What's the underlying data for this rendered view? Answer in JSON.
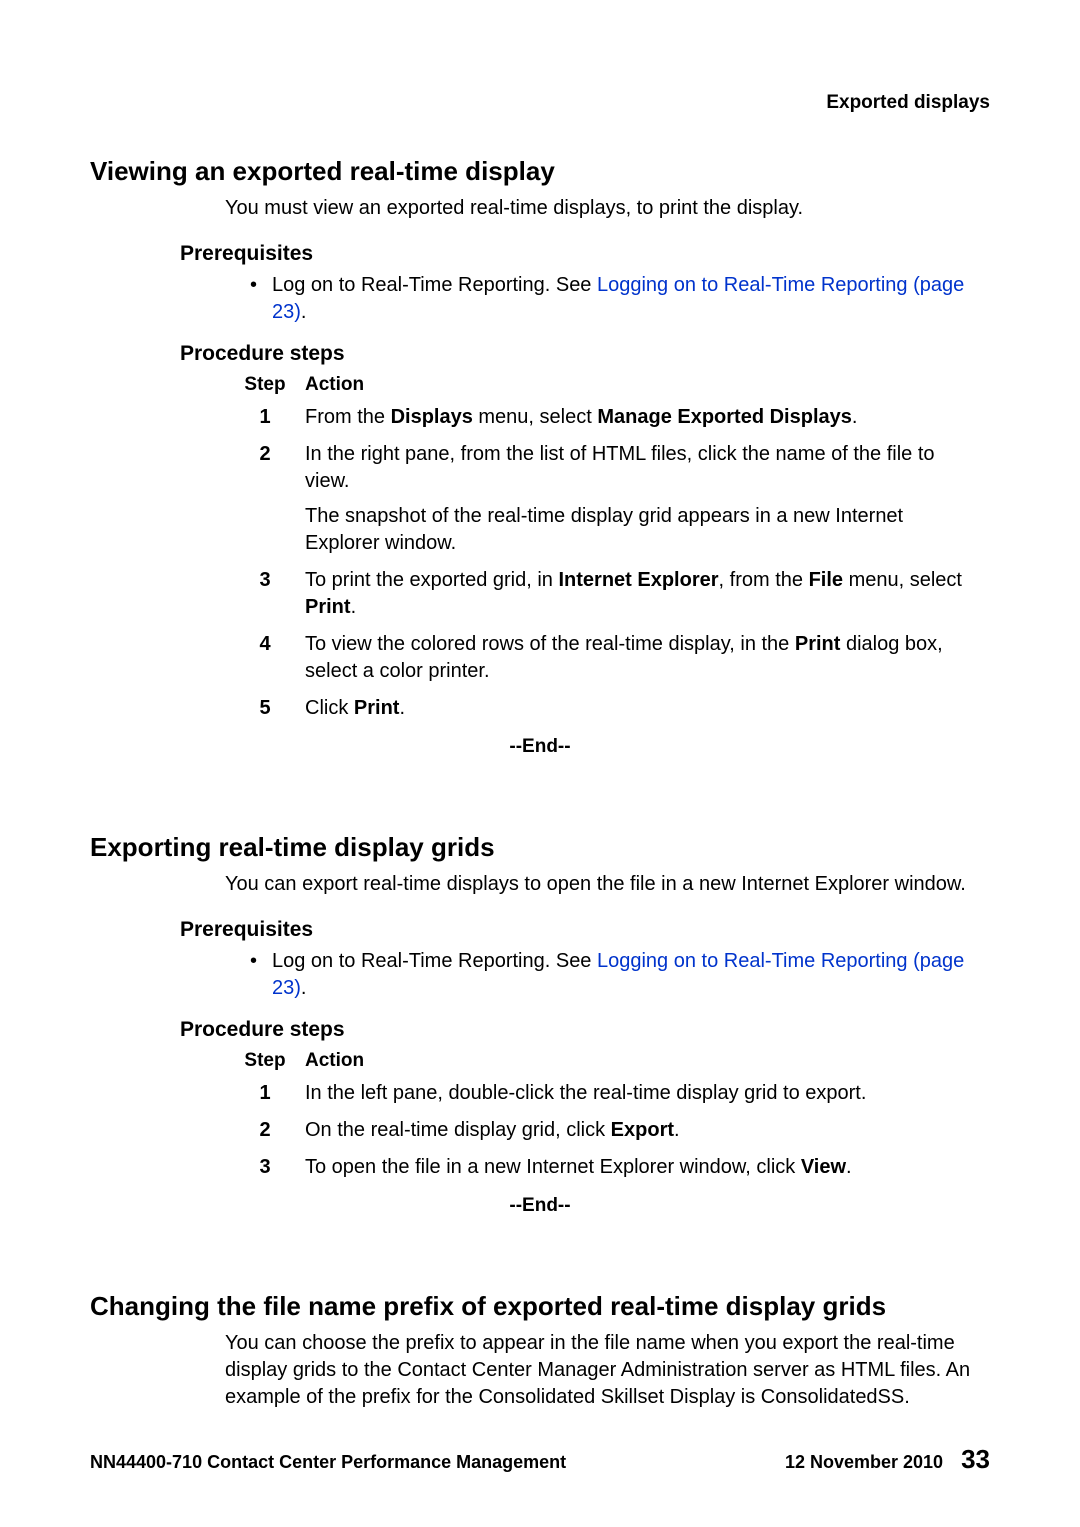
{
  "header_right": "Exported displays",
  "section1": {
    "title": "Viewing an exported real-time display",
    "intro": "You must view an exported real-time displays, to print the display.",
    "prereq_title": "Prerequisites",
    "prereq_text": "Log on to Real-Time Reporting. See ",
    "prereq_link": "Logging on to Real-Time Reporting (page 23)",
    "prereq_after": ".",
    "proc_title": "Procedure steps",
    "col_step": "Step",
    "col_action": "Action",
    "steps": {
      "s1num": "1",
      "s1_a": "From the ",
      "s1_b": "Displays",
      "s1_c": " menu, select ",
      "s1_d": "Manage Exported Displays",
      "s1_e": ".",
      "s2num": "2",
      "s2_p1": "In the right pane, from the list of HTML files, click the name of the file to view.",
      "s2_p2": "The snapshot of the real-time display grid appears in a new Internet Explorer window.",
      "s3num": "3",
      "s3_a": "To print the exported grid, in ",
      "s3_b": "Internet Explorer",
      "s3_c": ", from the ",
      "s3_d": "File",
      "s3_e": " menu, select ",
      "s3_f": "Print",
      "s3_g": ".",
      "s4num": "4",
      "s4_a": "To view the colored rows of the real-time display, in the ",
      "s4_b": "Print",
      "s4_c": " dialog box, select a color printer.",
      "s5num": "5",
      "s5_a": "Click ",
      "s5_b": "Print",
      "s5_c": "."
    },
    "end": "--End--"
  },
  "section2": {
    "title": "Exporting real-time display grids",
    "intro": "You can export real-time displays to open the file in a new Internet Explorer window.",
    "prereq_title": "Prerequisites",
    "prereq_text": "Log on to Real-Time Reporting. See ",
    "prereq_link": "Logging on to Real-Time Reporting (page 23)",
    "prereq_after": ".",
    "proc_title": "Procedure steps",
    "col_step": "Step",
    "col_action": "Action",
    "steps": {
      "s1num": "1",
      "s1": "In the left pane, double-click the real-time display grid to export.",
      "s2num": "2",
      "s2_a": "On the real-time display grid, click ",
      "s2_b": "Export",
      "s2_c": ".",
      "s3num": "3",
      "s3_a": "To open the file in a new Internet Explorer window, click ",
      "s3_b": "View",
      "s3_c": "."
    },
    "end": "--End--"
  },
  "section3": {
    "title": "Changing the file name prefix of exported real-time display grids",
    "intro": "You can choose the prefix to appear in the file name when you export the real-time display grids to the Contact Center Manager Administration server as HTML files. An example of the prefix for the Consolidated Skillset Display is ConsolidatedSS."
  },
  "footer": {
    "doc_id": "NN44400-710 Contact Center Performance Management",
    "date": "12 November 2010",
    "page": "33"
  }
}
